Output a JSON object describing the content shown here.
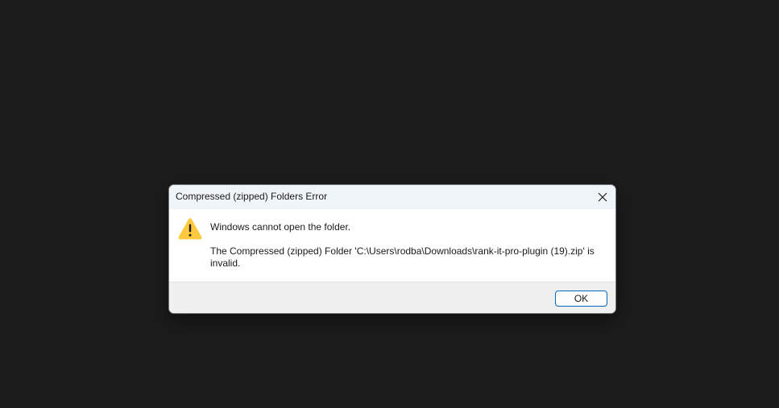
{
  "dialog": {
    "title": "Compressed (zipped) Folders Error",
    "close_icon": "close-icon",
    "message": "Windows cannot open the folder.",
    "detail": "The Compressed (zipped) Folder 'C:\\Users\\rodba\\Downloads\\rank-it-pro-plugin (19).zip' is invalid.",
    "icon": "warning-icon",
    "ok_label": "OK"
  },
  "colors": {
    "background": "#1c1c1c",
    "titlebar": "#eff4f9",
    "footer": "#f0f0f0",
    "accent": "#0067c0",
    "warning": "#ffc83d"
  }
}
